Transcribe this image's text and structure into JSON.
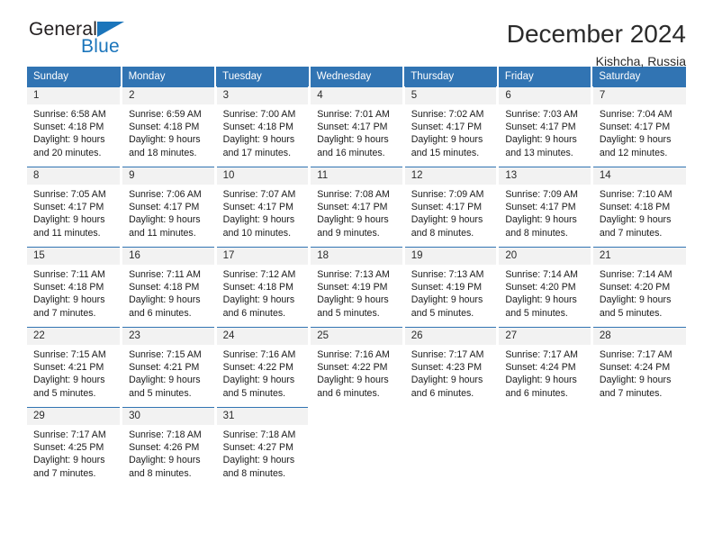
{
  "logo": {
    "text_primary": "General",
    "text_secondary": "Blue",
    "primary_color": "#231f20",
    "accent_color": "#1b75bb"
  },
  "header": {
    "title": "December 2024",
    "location": "Kishcha, Russia"
  },
  "theme": {
    "header_blue": "#3174b3",
    "daynum_background": "#f2f2f2",
    "page_background": "#ffffff"
  },
  "weekdays": [
    "Sunday",
    "Monday",
    "Tuesday",
    "Wednesday",
    "Thursday",
    "Friday",
    "Saturday"
  ],
  "weeks": [
    [
      {
        "day": "1",
        "sunrise": "Sunrise: 6:58 AM",
        "sunset": "Sunset: 4:18 PM",
        "daylight_line1": "Daylight: 9 hours",
        "daylight_line2": "and 20 minutes."
      },
      {
        "day": "2",
        "sunrise": "Sunrise: 6:59 AM",
        "sunset": "Sunset: 4:18 PM",
        "daylight_line1": "Daylight: 9 hours",
        "daylight_line2": "and 18 minutes."
      },
      {
        "day": "3",
        "sunrise": "Sunrise: 7:00 AM",
        "sunset": "Sunset: 4:18 PM",
        "daylight_line1": "Daylight: 9 hours",
        "daylight_line2": "and 17 minutes."
      },
      {
        "day": "4",
        "sunrise": "Sunrise: 7:01 AM",
        "sunset": "Sunset: 4:17 PM",
        "daylight_line1": "Daylight: 9 hours",
        "daylight_line2": "and 16 minutes."
      },
      {
        "day": "5",
        "sunrise": "Sunrise: 7:02 AM",
        "sunset": "Sunset: 4:17 PM",
        "daylight_line1": "Daylight: 9 hours",
        "daylight_line2": "and 15 minutes."
      },
      {
        "day": "6",
        "sunrise": "Sunrise: 7:03 AM",
        "sunset": "Sunset: 4:17 PM",
        "daylight_line1": "Daylight: 9 hours",
        "daylight_line2": "and 13 minutes."
      },
      {
        "day": "7",
        "sunrise": "Sunrise: 7:04 AM",
        "sunset": "Sunset: 4:17 PM",
        "daylight_line1": "Daylight: 9 hours",
        "daylight_line2": "and 12 minutes."
      }
    ],
    [
      {
        "day": "8",
        "sunrise": "Sunrise: 7:05 AM",
        "sunset": "Sunset: 4:17 PM",
        "daylight_line1": "Daylight: 9 hours",
        "daylight_line2": "and 11 minutes."
      },
      {
        "day": "9",
        "sunrise": "Sunrise: 7:06 AM",
        "sunset": "Sunset: 4:17 PM",
        "daylight_line1": "Daylight: 9 hours",
        "daylight_line2": "and 11 minutes."
      },
      {
        "day": "10",
        "sunrise": "Sunrise: 7:07 AM",
        "sunset": "Sunset: 4:17 PM",
        "daylight_line1": "Daylight: 9 hours",
        "daylight_line2": "and 10 minutes."
      },
      {
        "day": "11",
        "sunrise": "Sunrise: 7:08 AM",
        "sunset": "Sunset: 4:17 PM",
        "daylight_line1": "Daylight: 9 hours",
        "daylight_line2": "and 9 minutes."
      },
      {
        "day": "12",
        "sunrise": "Sunrise: 7:09 AM",
        "sunset": "Sunset: 4:17 PM",
        "daylight_line1": "Daylight: 9 hours",
        "daylight_line2": "and 8 minutes."
      },
      {
        "day": "13",
        "sunrise": "Sunrise: 7:09 AM",
        "sunset": "Sunset: 4:17 PM",
        "daylight_line1": "Daylight: 9 hours",
        "daylight_line2": "and 8 minutes."
      },
      {
        "day": "14",
        "sunrise": "Sunrise: 7:10 AM",
        "sunset": "Sunset: 4:18 PM",
        "daylight_line1": "Daylight: 9 hours",
        "daylight_line2": "and 7 minutes."
      }
    ],
    [
      {
        "day": "15",
        "sunrise": "Sunrise: 7:11 AM",
        "sunset": "Sunset: 4:18 PM",
        "daylight_line1": "Daylight: 9 hours",
        "daylight_line2": "and 7 minutes."
      },
      {
        "day": "16",
        "sunrise": "Sunrise: 7:11 AM",
        "sunset": "Sunset: 4:18 PM",
        "daylight_line1": "Daylight: 9 hours",
        "daylight_line2": "and 6 minutes."
      },
      {
        "day": "17",
        "sunrise": "Sunrise: 7:12 AM",
        "sunset": "Sunset: 4:18 PM",
        "daylight_line1": "Daylight: 9 hours",
        "daylight_line2": "and 6 minutes."
      },
      {
        "day": "18",
        "sunrise": "Sunrise: 7:13 AM",
        "sunset": "Sunset: 4:19 PM",
        "daylight_line1": "Daylight: 9 hours",
        "daylight_line2": "and 5 minutes."
      },
      {
        "day": "19",
        "sunrise": "Sunrise: 7:13 AM",
        "sunset": "Sunset: 4:19 PM",
        "daylight_line1": "Daylight: 9 hours",
        "daylight_line2": "and 5 minutes."
      },
      {
        "day": "20",
        "sunrise": "Sunrise: 7:14 AM",
        "sunset": "Sunset: 4:20 PM",
        "daylight_line1": "Daylight: 9 hours",
        "daylight_line2": "and 5 minutes."
      },
      {
        "day": "21",
        "sunrise": "Sunrise: 7:14 AM",
        "sunset": "Sunset: 4:20 PM",
        "daylight_line1": "Daylight: 9 hours",
        "daylight_line2": "and 5 minutes."
      }
    ],
    [
      {
        "day": "22",
        "sunrise": "Sunrise: 7:15 AM",
        "sunset": "Sunset: 4:21 PM",
        "daylight_line1": "Daylight: 9 hours",
        "daylight_line2": "and 5 minutes."
      },
      {
        "day": "23",
        "sunrise": "Sunrise: 7:15 AM",
        "sunset": "Sunset: 4:21 PM",
        "daylight_line1": "Daylight: 9 hours",
        "daylight_line2": "and 5 minutes."
      },
      {
        "day": "24",
        "sunrise": "Sunrise: 7:16 AM",
        "sunset": "Sunset: 4:22 PM",
        "daylight_line1": "Daylight: 9 hours",
        "daylight_line2": "and 5 minutes."
      },
      {
        "day": "25",
        "sunrise": "Sunrise: 7:16 AM",
        "sunset": "Sunset: 4:22 PM",
        "daylight_line1": "Daylight: 9 hours",
        "daylight_line2": "and 6 minutes."
      },
      {
        "day": "26",
        "sunrise": "Sunrise: 7:17 AM",
        "sunset": "Sunset: 4:23 PM",
        "daylight_line1": "Daylight: 9 hours",
        "daylight_line2": "and 6 minutes."
      },
      {
        "day": "27",
        "sunrise": "Sunrise: 7:17 AM",
        "sunset": "Sunset: 4:24 PM",
        "daylight_line1": "Daylight: 9 hours",
        "daylight_line2": "and 6 minutes."
      },
      {
        "day": "28",
        "sunrise": "Sunrise: 7:17 AM",
        "sunset": "Sunset: 4:24 PM",
        "daylight_line1": "Daylight: 9 hours",
        "daylight_line2": "and 7 minutes."
      }
    ],
    [
      {
        "day": "29",
        "sunrise": "Sunrise: 7:17 AM",
        "sunset": "Sunset: 4:25 PM",
        "daylight_line1": "Daylight: 9 hours",
        "daylight_line2": "and 7 minutes."
      },
      {
        "day": "30",
        "sunrise": "Sunrise: 7:18 AM",
        "sunset": "Sunset: 4:26 PM",
        "daylight_line1": "Daylight: 9 hours",
        "daylight_line2": "and 8 minutes."
      },
      {
        "day": "31",
        "sunrise": "Sunrise: 7:18 AM",
        "sunset": "Sunset: 4:27 PM",
        "daylight_line1": "Daylight: 9 hours",
        "daylight_line2": "and 8 minutes."
      },
      {
        "day": "",
        "sunrise": "",
        "sunset": "",
        "daylight_line1": "",
        "daylight_line2": ""
      },
      {
        "day": "",
        "sunrise": "",
        "sunset": "",
        "daylight_line1": "",
        "daylight_line2": ""
      },
      {
        "day": "",
        "sunrise": "",
        "sunset": "",
        "daylight_line1": "",
        "daylight_line2": ""
      },
      {
        "day": "",
        "sunrise": "",
        "sunset": "",
        "daylight_line1": "",
        "daylight_line2": ""
      }
    ]
  ]
}
